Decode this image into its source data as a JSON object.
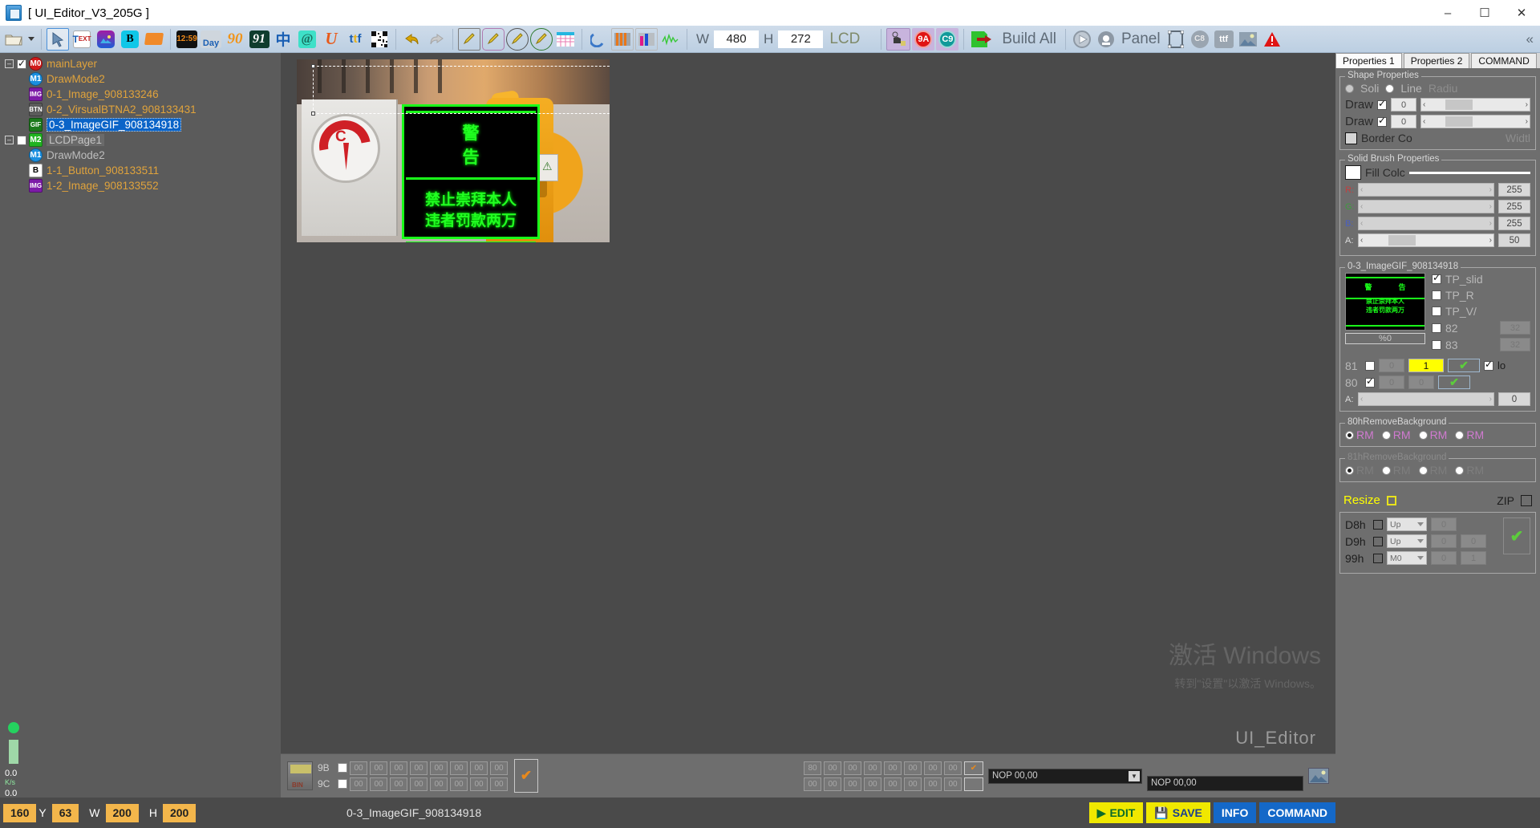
{
  "window": {
    "title": "[ UI_Editor_V3_205G ]",
    "icon": "app-icon",
    "minimize": "–",
    "maximize": "☐",
    "close": "✕"
  },
  "toolbar": {
    "items": [
      {
        "name": "open-file",
        "glyph": "🗀",
        "kind": "folder"
      },
      {
        "name": "open-file-dropdown",
        "glyph": "▾",
        "kind": "caret"
      },
      {
        "name": "select-arrow",
        "glyph": "↖",
        "kind": "arrow",
        "selected": true
      },
      {
        "name": "text-tool",
        "glyph": "T",
        "kind": "text"
      },
      {
        "name": "image-tool",
        "glyph": "▲",
        "kind": "image"
      },
      {
        "name": "button-tool",
        "glyph": "B",
        "kind": "bold"
      },
      {
        "name": "shape-tool",
        "glyph": "▬",
        "kind": "rect"
      },
      {
        "name": "clock-tool",
        "glyph": "12:59",
        "kind": "clock"
      },
      {
        "name": "day-tool",
        "glyph": "Day",
        "kind": "day"
      },
      {
        "name": "number90-tool",
        "glyph": "90",
        "kind": "n90"
      },
      {
        "name": "number91-tool",
        "glyph": "91",
        "kind": "n91"
      },
      {
        "name": "chinese-font-tool",
        "glyph": "中",
        "kind": "cn"
      },
      {
        "name": "at-tool",
        "glyph": "@",
        "kind": "at"
      },
      {
        "name": "unicode-tool",
        "glyph": "U",
        "kind": "u"
      },
      {
        "name": "ttf-tool",
        "glyph": "ttf",
        "kind": "ttf"
      },
      {
        "name": "qrcode-tool",
        "glyph": "▦",
        "kind": "qr"
      },
      {
        "name": "undo-button",
        "glyph": "↶",
        "kind": "undo"
      },
      {
        "name": "redo-button",
        "glyph": "↷",
        "kind": "redo"
      },
      {
        "name": "pen-rect-tool",
        "glyph": "✎",
        "kind": "pen1"
      },
      {
        "name": "pen-roundrect-tool",
        "glyph": "✎",
        "kind": "pen2"
      },
      {
        "name": "pen-circle-tool",
        "glyph": "✎",
        "kind": "pen3"
      },
      {
        "name": "pen-ellipse-tool",
        "glyph": "✎",
        "kind": "pen4"
      },
      {
        "name": "grid-tool",
        "glyph": "▦",
        "kind": "grid"
      },
      {
        "name": "arc-tool",
        "glyph": "◡",
        "kind": "arc"
      },
      {
        "name": "bars-tool",
        "glyph": "▮",
        "kind": "bars"
      },
      {
        "name": "chart-tool",
        "glyph": "▌",
        "kind": "chart"
      },
      {
        "name": "waveform-tool",
        "glyph": "〜",
        "kind": "wave"
      }
    ],
    "width_label": "W",
    "width_value": "480",
    "height_label": "H",
    "height_value": "272",
    "lcd_label": "LCD",
    "hand_icon": "hand-icon",
    "badge_9a": "9A",
    "badge_c9": "C9",
    "build_all": "Build All",
    "play_icon": "play-icon",
    "cam_icon": "camera-icon",
    "panel_label": "Panel",
    "panel_icon": "panel-icon",
    "c8_icon": "c8-icon",
    "ttf_icon": "ttf-icon",
    "img_icon": "img-icon",
    "warn_icon": "warning-icon",
    "collapse_icon": "«"
  },
  "tree": {
    "nodes": [
      {
        "name": "mainLayer",
        "badge": "M0",
        "badge_color": "#d11b1b",
        "badge_shape": "circle",
        "indent": 0,
        "expander": "–",
        "checkbox": "checked",
        "style": "amber"
      },
      {
        "name": "DrawMode2",
        "badge": "M1",
        "badge_color": "#1a8fe0",
        "badge_shape": "circle",
        "indent": 1,
        "style": "amber"
      },
      {
        "name": "0-1_Image_908133246",
        "badge": "IMG",
        "badge_color": "#7d1ba8",
        "badge_shape": "square",
        "indent": 1,
        "style": "amber"
      },
      {
        "name": "0-2_VirsualBTNA2_908133431",
        "badge": "BTN",
        "badge_color": "#5b5b5b",
        "badge_shape": "square",
        "indent": 1,
        "style": "amber"
      },
      {
        "name": "0-3_ImageGIF_908134918",
        "badge": "GIF",
        "badge_color": "#1c7a1c",
        "badge_shape": "square",
        "indent": 1,
        "style": "selected"
      },
      {
        "name": "LCDPage1",
        "badge": "M2",
        "badge_color": "#21b321",
        "badge_shape": "square",
        "indent": 0,
        "expander": "–",
        "checkbox": "unchecked",
        "style": "grey"
      },
      {
        "name": "DrawMode2",
        "badge": "M1",
        "badge_color": "#1a8fe0",
        "badge_shape": "circle",
        "indent": 1,
        "style": "grey-plain"
      },
      {
        "name": "1-1_Button_908133511",
        "badge": "B",
        "badge_color": "#ffffff",
        "badge_shape": "square",
        "indent": 1,
        "style": "amber"
      },
      {
        "name": "1-2_Image_908133552",
        "badge": "IMG",
        "badge_color": "#7d1ba8",
        "badge_shape": "square",
        "indent": 1,
        "style": "amber"
      }
    ]
  },
  "canvas": {
    "sign": {
      "title_line": "警　告",
      "body_line1": "禁止崇拜本人",
      "body_line2": "违者罚款两万",
      "led_color": "#22ff22"
    }
  },
  "properties": {
    "tabs": [
      {
        "label": "Properties 1",
        "active": true
      },
      {
        "label": "Properties 2",
        "active": false
      },
      {
        "label": "COMMAND",
        "active": false
      }
    ],
    "shape_group": {
      "title": "Shape Properties",
      "solid_label": "Soli",
      "line_label": "Line",
      "radius_label": "Radiu",
      "draw1_label": "Draw",
      "draw1_value": "0",
      "draw2_label": "Draw",
      "draw2_value": "0",
      "border_label": "Border Co",
      "width_label": "Widtl"
    },
    "brush_group": {
      "title": "Solid Brush Properties",
      "fill_label": "Fill Colc",
      "channels": [
        {
          "name": "R:",
          "value": "255"
        },
        {
          "name": "G:",
          "value": "255"
        },
        {
          "name": "B:",
          "value": "255"
        },
        {
          "name": "A:",
          "value": "50"
        }
      ]
    },
    "gif_group": {
      "title": "0-3_ImageGIF_908134918",
      "progress_label": "%0",
      "checks": [
        {
          "label": "TP_slid",
          "checked": true,
          "value": null
        },
        {
          "label": "TP_R",
          "checked": false,
          "value": null
        },
        {
          "label": "TP_V/",
          "checked": false,
          "value": null
        },
        {
          "label": "82",
          "checked": false,
          "value": "32"
        },
        {
          "label": "83",
          "checked": false,
          "value": "32"
        }
      ],
      "row81": {
        "label": "81",
        "checked": false,
        "v1": "0",
        "v2": "1",
        "ok": "✔",
        "lo_checked": true,
        "lo_label": "lo"
      },
      "row80": {
        "label": "80",
        "checked": true,
        "v1": "0",
        "v2": "0",
        "ok": "✔"
      },
      "alpha_label": "A:",
      "alpha_value": "0"
    },
    "rm80_group": {
      "title": "80hRemoveBackground",
      "options": [
        {
          "label": "RM",
          "selected": true
        },
        {
          "label": "RM",
          "selected": false
        },
        {
          "label": "RM",
          "selected": false
        },
        {
          "label": "RM",
          "selected": false
        }
      ]
    },
    "rm81_group": {
      "title": "81hRemoveBackground",
      "options": [
        {
          "label": "RM",
          "selected": true
        },
        {
          "label": "RM",
          "selected": false
        },
        {
          "label": "RM",
          "selected": false
        },
        {
          "label": "RM",
          "selected": false
        }
      ]
    },
    "resize": {
      "label": "Resize",
      "checked": false,
      "zip_label": "ZIP",
      "zip_checked": false,
      "rows": [
        {
          "label": "D8h",
          "checked": false,
          "combo": "Up",
          "v1": "0",
          "v2": "",
          "ok": "✔"
        },
        {
          "label": "D9h",
          "checked": false,
          "combo": "Up",
          "v1": "0",
          "v2": "0",
          "ok": ""
        },
        {
          "label": "99h",
          "checked": false,
          "combo": "M0",
          "v1": "0",
          "v2": "1",
          "ok": ""
        }
      ]
    }
  },
  "bottom": {
    "bin_icon": "bin-icon",
    "rows": [
      {
        "label": "9B",
        "checked": false,
        "cells": [
          "00",
          "00",
          "00",
          "00",
          "00",
          "00",
          "00",
          "00"
        ]
      },
      {
        "label": "9C",
        "checked": false,
        "cells": [
          "00",
          "00",
          "00",
          "00",
          "00",
          "00",
          "00",
          "00"
        ]
      }
    ],
    "confirm": "✔",
    "right_rows": [
      {
        "cells": [
          "80",
          "00",
          "00",
          "00",
          "00",
          "00",
          "00",
          "00"
        ],
        "ok": "✔"
      },
      {
        "cells": [
          "00",
          "00",
          "00",
          "00",
          "00",
          "00",
          "00",
          "00"
        ],
        "ok": ""
      }
    ],
    "nop_select": "NOP 00,00",
    "nop_text": "NOP 00,00",
    "img_icon": "image-icon"
  },
  "statusbar": {
    "x_label": "",
    "x_value": "160",
    "y_label": "Y",
    "y_value": "63",
    "w_label": "W",
    "w_value": "200",
    "h_label": "H",
    "h_value": "200",
    "selected_object": "0-3_ImageGIF_908134918",
    "buttons": [
      {
        "label": "EDIT",
        "kind": "edit",
        "icon": "▶"
      },
      {
        "label": "SAVE",
        "kind": "save",
        "icon": "💾"
      },
      {
        "label": "INFO",
        "kind": "info",
        "icon": ""
      },
      {
        "label": "COMMAND",
        "kind": "cmd",
        "icon": ""
      }
    ],
    "rate_top": "0.0",
    "rate_top_unit": "K/s",
    "rate_bottom": "0.0",
    "rate_bottom_unit": "K/s"
  },
  "watermark": {
    "line1": "激活 Windows",
    "line2": "转到\"设置\"以激活 Windows。",
    "logo": "UI_Editor"
  }
}
